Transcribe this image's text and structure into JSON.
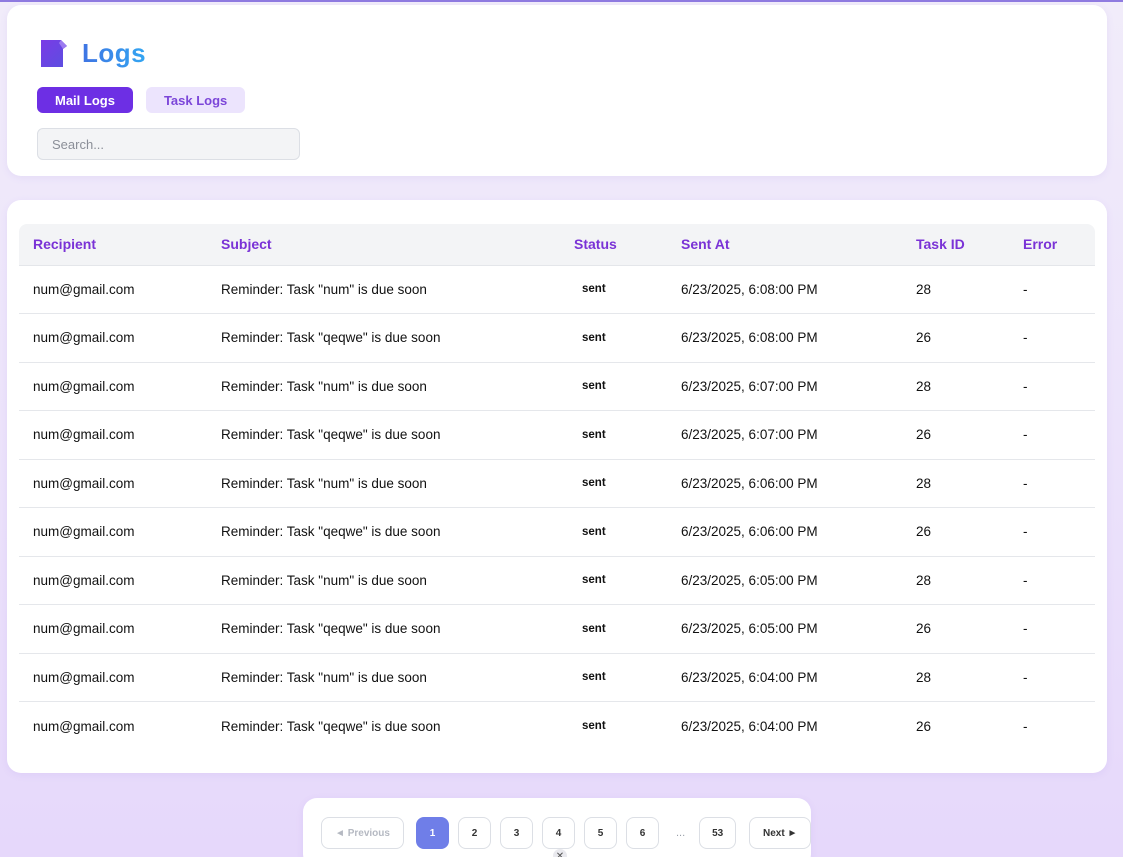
{
  "header": {
    "title": "Logs",
    "tabs": [
      {
        "label": "Mail Logs",
        "active": true
      },
      {
        "label": "Task Logs",
        "active": false
      }
    ],
    "search": {
      "placeholder": "Search...",
      "value": ""
    }
  },
  "table": {
    "columns": [
      "Recipient",
      "Subject",
      "Status",
      "Sent At",
      "Task ID",
      "Error"
    ],
    "rows": [
      [
        "num@gmail.com",
        "Reminder: Task \"num\" is due soon",
        "sent",
        "6/23/2025, 6:08:00 PM",
        "28",
        "-"
      ],
      [
        "num@gmail.com",
        "Reminder: Task \"qeqwe\" is due soon",
        "sent",
        "6/23/2025, 6:08:00 PM",
        "26",
        "-"
      ],
      [
        "num@gmail.com",
        "Reminder: Task \"num\" is due soon",
        "sent",
        "6/23/2025, 6:07:00 PM",
        "28",
        "-"
      ],
      [
        "num@gmail.com",
        "Reminder: Task \"qeqwe\" is due soon",
        "sent",
        "6/23/2025, 6:07:00 PM",
        "26",
        "-"
      ],
      [
        "num@gmail.com",
        "Reminder: Task \"num\" is due soon",
        "sent",
        "6/23/2025, 6:06:00 PM",
        "28",
        "-"
      ],
      [
        "num@gmail.com",
        "Reminder: Task \"qeqwe\" is due soon",
        "sent",
        "6/23/2025, 6:06:00 PM",
        "26",
        "-"
      ],
      [
        "num@gmail.com",
        "Reminder: Task \"num\" is due soon",
        "sent",
        "6/23/2025, 6:05:00 PM",
        "28",
        "-"
      ],
      [
        "num@gmail.com",
        "Reminder: Task \"qeqwe\" is due soon",
        "sent",
        "6/23/2025, 6:05:00 PM",
        "26",
        "-"
      ],
      [
        "num@gmail.com",
        "Reminder: Task \"num\" is due soon",
        "sent",
        "6/23/2025, 6:04:00 PM",
        "28",
        "-"
      ],
      [
        "num@gmail.com",
        "Reminder: Task \"qeqwe\" is due soon",
        "sent",
        "6/23/2025, 6:04:00 PM",
        "26",
        "-"
      ]
    ]
  },
  "pagination": {
    "previous_label": "◄ Previous",
    "next_label": "Next ►",
    "pages": [
      "1",
      "2",
      "3",
      "4",
      "5",
      "6"
    ],
    "current_page": "1",
    "ellipsis": "...",
    "last_page": "53"
  },
  "overlay": {
    "close_glyph": "✕"
  },
  "colors": {
    "accent": "#6d2fe4",
    "header_text": "#7a32d6",
    "current_page": "#6f7ee8",
    "title_gradient_start": "#3f74e3",
    "title_gradient_end": "#33a6f2"
  }
}
